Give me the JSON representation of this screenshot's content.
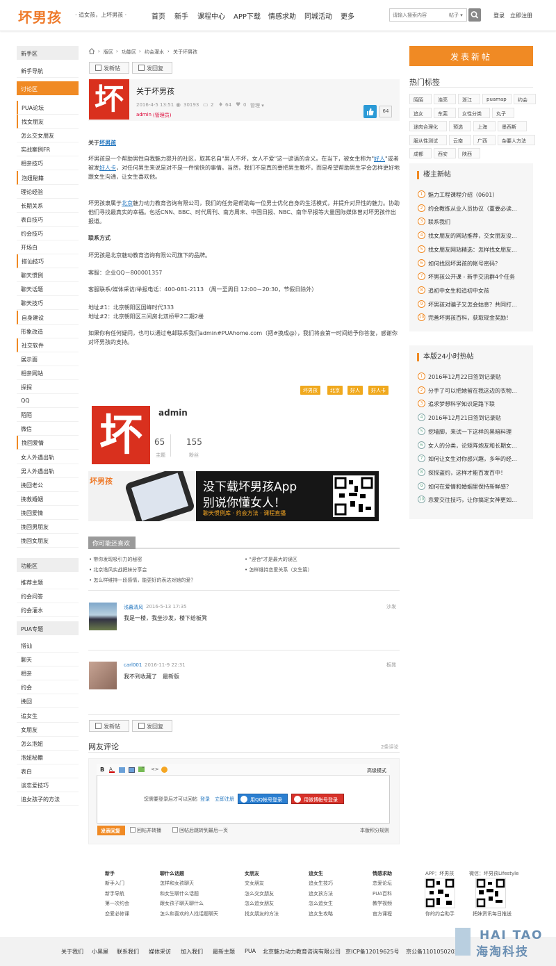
{
  "header": {
    "logo": "坏男孩",
    "slogan": "· 追女孩，上坏男孩 ·",
    "nav": [
      "首页",
      "新手",
      "课程中心",
      "APP下载",
      "情感求助",
      "同城活动",
      "更多"
    ],
    "search_placeholder": "请输入搜索内容",
    "search_type": "帖子 ▾",
    "login": "登录",
    "register": "立即注册"
  },
  "left_sidebar": {
    "sections": [
      {
        "label": "新手区",
        "active": false
      },
      {
        "label": "讨论区",
        "active": true
      },
      {
        "label": "功能区",
        "active": false
      },
      {
        "label": "PUA专题",
        "active": false
      }
    ],
    "newbie_items": [
      "新手导航"
    ],
    "discuss_items": [
      "PUA论坛",
      "找女朋友",
      "怎么交女朋友",
      "实战案例FR",
      "相亲技巧",
      "泡妞秘籍",
      "理论经验",
      "长期关系",
      "表白技巧",
      "约会技巧",
      "开场白",
      "搭讪技巧",
      "聊天惯例",
      "聊天话题",
      "聊天技巧",
      "自身建设",
      "形象改造",
      "社交软件",
      "展示面",
      "相亲网站",
      "探探",
      "QQ",
      "陌陌",
      "微信",
      "挽回爱情",
      "女人外遇出轨",
      "男人外遇出轨",
      "挽回老公",
      "挽救婚姻",
      "挽回爱情",
      "挽回男朋友",
      "挽回女朋友"
    ],
    "function_items": [
      "推荐主题",
      "约会问答",
      "约会灌水"
    ],
    "pua_items": [
      "搭讪",
      "聊天",
      "相亲",
      "约会",
      "挽回",
      "追女生",
      "女朋友",
      "怎么泡妞",
      "泡妞秘籍",
      "表白",
      "谈恋爱技巧",
      "追女孩子的方法"
    ]
  },
  "breadcrumb": [
    "版区",
    "功能区",
    "约会灌水",
    "关于坏男孩"
  ],
  "buttons": {
    "new_post": "发新帖",
    "reply": "发回复"
  },
  "thread": {
    "logo_char": "坏",
    "title": "关于坏男孩",
    "date": "2016-4-5 13:51",
    "views": "30193",
    "replies": "2",
    "likes": "64",
    "favs": "0",
    "manage": "管理 ▾",
    "author": "admin",
    "author_role": "(管理员)",
    "like_count": "64"
  },
  "content": {
    "p1_title": "关于",
    "p1_title_link": "坏男孩",
    "p2_a": "坏男孩是一个帮助男性自我魅力提升的社区，取其名自\"男人不坏，女人不爱\"这一谚语的含义。在当下，被女生称为\"",
    "p2_link1": "好人",
    "p2_b": "\"或者被发",
    "p2_link2": "好人卡",
    "p2_c": "，对任何男生来说是对不是一件愉快的事情。当然，我们不是真的要把男生教坏，而是希望帮助男生学会怎样更好地跟女生沟通，让女生喜欢他。",
    "p3_a": "坏男孩隶属于",
    "p3_link": "北京",
    "p3_b": "魅力动力教育咨询有限公司，我们的任务是帮助每一位男士优化自身的生活模式，并提升对异性的魅力。协助他们寻找最真实的幸福。包括CNN、BBC、时代周刊、南方周末、中国日报、NBC、南华早报等大量国际媒体曾对坏男孩作出报道。",
    "contact_title": "联系方式",
    "line1": "坏男孩是北京魅动教育咨询有限公司旗下的品牌。",
    "line2": "客服：企业QQ－800001357",
    "line3": "客服联系/媒体采访/举报电话：400-081-2113 （周一至周日 12:00－20:30，节假日除外）",
    "line4": "地址#1：北京朝阳区国峰时代333",
    "line5": "地址#2：北京朝阳区三间房北双桥甲2二期2楼",
    "line6": "如果你有任何疑问，也可以通过电邮联系我们admin#PUAhome.com（把#换成@），我们将会第一时间给予你答复，感谢你对坏男孩的支持。"
  },
  "tags": [
    "坏男孩",
    "北京",
    "好人",
    "好人卡"
  ],
  "author_card": {
    "logo_char": "坏",
    "name": "admin",
    "topics_num": "65",
    "topics_label": "主题",
    "fans_num": "155",
    "fans_label": "粉丝"
  },
  "banner": {
    "brand": "坏男孩",
    "line1": "没下载坏男孩App",
    "line2": "别说你懂女人！",
    "sub": "聊天惯例库 · 约会方法 · 课程直播"
  },
  "related": {
    "title": "你可能还喜欢",
    "items": [
      "带你发现吸引力的秘密",
      "\"迎合\"才是最大的误区",
      "北京逸风实战把妹分享会",
      "怎样维持恋爱关系（女生篇）",
      "怎么样维持一段感情，能更好的表达对她的爱？"
    ]
  },
  "replies": [
    {
      "user": "浅暮清风",
      "date": "2016-5-13 17:35",
      "floor": "沙发",
      "text": "我是一楼，我坐沙发，楼下给板凳"
    },
    {
      "user": "carl001",
      "date": "2016-11-9 22:31",
      "floor": "板凳",
      "text": "我不到收藏了　最新版"
    }
  ],
  "comments": {
    "title": "网友评论",
    "count": "2条评论",
    "advanced": "高级模式",
    "login_prompt": "您需要登录后才可以回帖",
    "login": "登录",
    "register": "立即注册",
    "qq_btn": "用QQ帐号登录",
    "weibo_btn": "用微博帐号登录",
    "submit": "发表回复",
    "opt1": "回帖并转播",
    "opt2": "回帖后跳转到最后一页",
    "rules": "本版积分规则"
  },
  "right": {
    "post_btn": "发表新帖",
    "hot_tags_title": "热门标签",
    "hot_tags": [
      [
        "陌陌",
        "浩亮",
        "浙江",
        "puamap",
        "约会"
      ],
      [
        "追女",
        "东莞",
        "女性分类",
        "丸子"
      ],
      [
        "迷肉合理化",
        "预选",
        "上海",
        "墨西斯"
      ],
      [
        "服从性测试",
        "云南",
        "广西",
        "杂要人方法"
      ],
      [
        "成都",
        "西安",
        "陕西"
      ]
    ],
    "new_title": "楼主新帖",
    "new_posts": [
      "魅力工程课程介绍（0601）",
      "约会教练从业人员协议（重要必读...",
      "联系我们",
      "找女朋友的网站推荐，交女朋友没...",
      "找女朋友网站精选：怎样找女朋友...",
      "如何找回坏男孩的帐号密码？",
      "坏男孩公开课 - 新手交流群4个任务",
      "追初中女生和追初中女孩",
      "坏男孩对骗子又怎会姑息？共同打...",
      "完善坏男孩百科，获取现金奖励！"
    ],
    "hot_title": "本版24小时热帖",
    "hot_posts": [
      "2016年12月22日签到记录贴",
      "分手了可以把她留在我这边的衣物...",
      "追求梦想科学知识是路下联",
      "2016年12月21日签到记录贴",
      "挖墙脚，来试一下这样的黑暗料理",
      "女人的分类，论矩阵炮友和长期女...",
      "如何让女生对你感兴趣，多年的经...",
      "探探盗约，这样才能百发百中！",
      "如何在爱情和婚姻里保持新鲜感？",
      "恋爱交往技巧，让你搞定女神更如..."
    ]
  },
  "footer": {
    "cols": [
      {
        "h": "新手",
        "items": [
          "新手入门",
          "新手导航",
          "第一次约会",
          "恋爱必修课"
        ]
      },
      {
        "h": "聊什么话题",
        "items": [
          "怎样和女孩聊天",
          "和女生聊什么话题",
          "跟女孩子聊天聊什么",
          "怎么和喜欢的人找话题聊天"
        ]
      },
      {
        "h": "女朋友",
        "items": [
          "交女朋友",
          "怎么交女朋友",
          "怎么追女朋友",
          "找女朋友的方法"
        ]
      },
      {
        "h": "追女生",
        "items": [
          "追女生技巧",
          "追女孩方法",
          "怎么追女生",
          "追女生攻略"
        ]
      },
      {
        "h": "情感求助",
        "items": [
          "恋爱论坛",
          "PUA百科",
          "教学视频",
          "官方课程"
        ]
      }
    ],
    "app_label": "APP：坏男孩",
    "app_sub": "你的约会助手",
    "wx_label": "微信：坏男孩Lifestyle",
    "wx_sub": "把妹资讯每日推送",
    "bottom": [
      "关于我们",
      "小黑屋",
      "联系我们",
      "媒体采访",
      "加入我们",
      "最新主题",
      "PUA",
      "北京魅力动力教育咨询有限公司",
      "京ICP备12019625号",
      "京公备110105020264"
    ],
    "watermark_en": "HAI TAO",
    "watermark_cn": "海淘科技"
  }
}
